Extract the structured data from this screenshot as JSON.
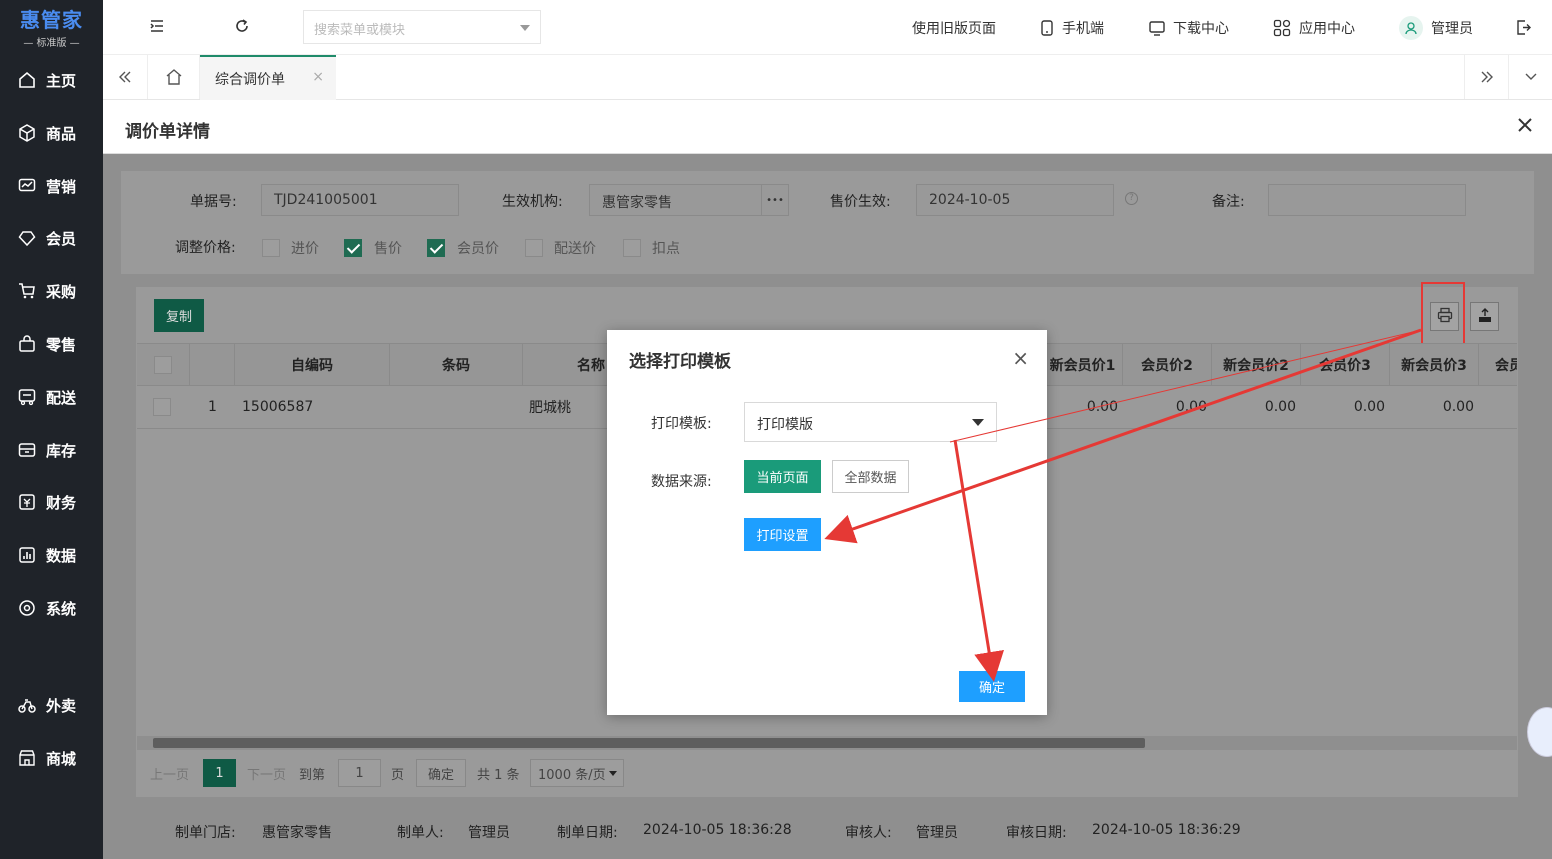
{
  "sidebar": {
    "brand": "惠管家",
    "edition": "— 标准版 —",
    "items": [
      {
        "label": "主页",
        "icon": "home-icon"
      },
      {
        "label": "商品",
        "icon": "box-icon"
      },
      {
        "label": "营销",
        "icon": "chart-icon"
      },
      {
        "label": "会员",
        "icon": "diamond-icon"
      },
      {
        "label": "采购",
        "icon": "cart-icon"
      },
      {
        "label": "零售",
        "icon": "bag-icon"
      },
      {
        "label": "配送",
        "icon": "truck-icon"
      },
      {
        "label": "库存",
        "icon": "warehouse-icon"
      },
      {
        "label": "财务",
        "icon": "finance-icon"
      },
      {
        "label": "数据",
        "icon": "data-icon"
      },
      {
        "label": "系统",
        "icon": "settings-icon"
      },
      {
        "label": "外卖",
        "icon": "bike-icon"
      },
      {
        "label": "商城",
        "icon": "store-icon"
      }
    ]
  },
  "topbar": {
    "search_placeholder": "搜索菜单或模块",
    "old_page": "使用旧版页面",
    "mobile": "手机端",
    "download": "下载中心",
    "apps": "应用中心",
    "user": "管理员"
  },
  "tabs": {
    "active": "综合调价单",
    "close": "×"
  },
  "detail": {
    "title": "调价单详情",
    "form": {
      "doc_no_label": "单据号:",
      "doc_no": "TJD241005001",
      "org_label": "生效机构:",
      "org": "惠管家零售",
      "org_more": "•••",
      "effective_label": "售价生效:",
      "effective": "2024-10-05",
      "remark_label": "备注:",
      "adjust_label": "调整价格:",
      "options": [
        {
          "label": "进价",
          "checked": false
        },
        {
          "label": "售价",
          "checked": true
        },
        {
          "label": "会员价",
          "checked": true
        },
        {
          "label": "配送价",
          "checked": false
        },
        {
          "label": "扣点",
          "checked": false
        }
      ]
    },
    "copy_button": "复制",
    "table": {
      "headers": [
        "",
        "",
        "自编码",
        "条码",
        "名称",
        "新会员价1",
        "会员价2",
        "新会员价2",
        "会员价3",
        "新会员价3",
        "会员"
      ],
      "rows": [
        {
          "index": "1",
          "code": "15006587",
          "barcode": "",
          "name": "肥城桃",
          "v1": "0.00",
          "v2": "0.00",
          "v3": "0.00",
          "v4": "0.00",
          "v5": "0.00"
        }
      ]
    },
    "pager": {
      "prev": "上一页",
      "page": "1",
      "next": "下一页",
      "goto": "到第",
      "goto_value": "1",
      "page_unit": "页",
      "confirm": "确定",
      "total": "共 1 条",
      "page_size": "1000 条/页"
    },
    "footer": {
      "store_label": "制单门店:",
      "store": "惠管家零售",
      "maker_label": "制单人:",
      "maker": "管理员",
      "date_label": "制单日期:",
      "date": "2024-10-05 18:36:28",
      "auditor_label": "审核人:",
      "auditor": "管理员",
      "audit_date_label": "审核日期:",
      "audit_date": "2024-10-05 18:36:29"
    }
  },
  "modal": {
    "title": "选择打印模板",
    "template_label": "打印模板:",
    "template_value": "打印模版",
    "source_label": "数据来源:",
    "current_page": "当前页面",
    "all_data": "全部数据",
    "print_settings": "打印设置",
    "confirm": "确定",
    "close": "×"
  },
  "colors": {
    "sidebar_bg": "#1f2329",
    "brand": "#4a8cf0",
    "primary_green": "#1a9b7a",
    "primary_blue": "#1e9fff",
    "annotation_red": "#e53935"
  }
}
